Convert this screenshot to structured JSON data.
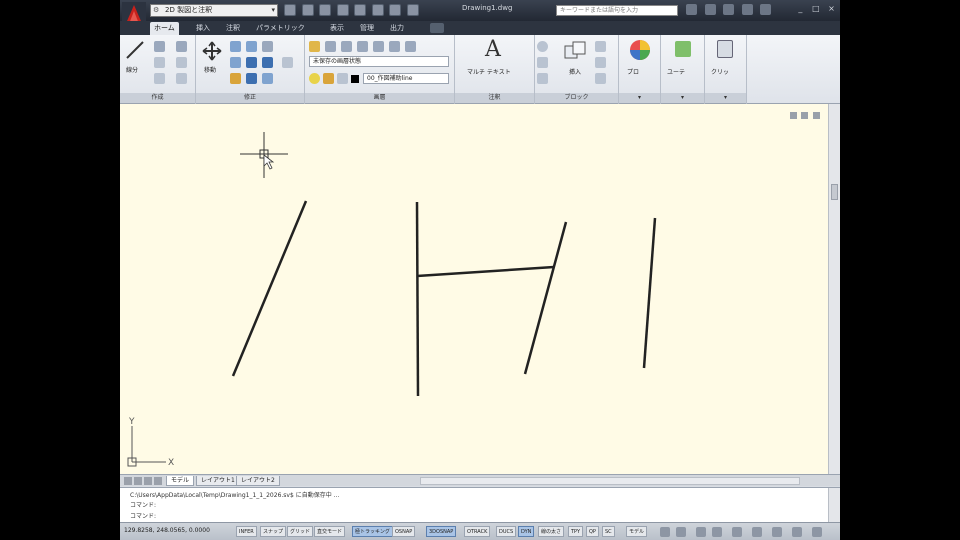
{
  "titlebar": {
    "workspace": "2D 製図と注釈",
    "file_title": "Drawing1.dwg",
    "search_placeholder": "キーワードまたは語句を入力",
    "win_min": "_",
    "win_max": "□",
    "win_close": "×"
  },
  "ribbon_tabs": [
    {
      "label": "ホーム",
      "active": true
    },
    {
      "label": "挿入"
    },
    {
      "label": "注釈"
    },
    {
      "label": "パラメトリック"
    },
    {
      "label": "表示"
    },
    {
      "label": "管理"
    },
    {
      "label": "出力"
    }
  ],
  "panels": {
    "draw": {
      "label": "作成",
      "line": "線分"
    },
    "modify": {
      "label": "修正",
      "move": "移動"
    },
    "layers": {
      "label": "画層",
      "state": "未保存の画層状態",
      "current": "00_作図補助line"
    },
    "annotation": {
      "label": "注釈",
      "mtext": "マルチ テキスト"
    },
    "block": {
      "label": "ブロック",
      "insert": "挿入"
    },
    "properties": {
      "label": "プロ"
    },
    "utilities": {
      "label": "ユーテ"
    },
    "clipboard": {
      "label": "クリッ"
    }
  },
  "layout_tabs": [
    "モデル",
    "レイアウト1",
    "レイアウト2"
  ],
  "command": {
    "line1": "C:\\Users\\AppData\\Local\\Temp\\Drawing1_1_1_2026.sv$ に自動保存中 ...",
    "line2": "コマンド:",
    "line3": "コマンド:"
  },
  "ucs": {
    "x": "X",
    "y": "Y"
  },
  "status": {
    "coords": "129.8258, 248.0565, 0.0000",
    "toggles": [
      {
        "label": "INFER",
        "on": false
      },
      {
        "label": "スナップ",
        "on": false
      },
      {
        "label": "グリッド",
        "on": false
      },
      {
        "label": "直交モード",
        "on": false
      },
      {
        "label": "極トラッキング",
        "on": true
      },
      {
        "label": "OSNAP",
        "on": false
      },
      {
        "label": "3DOSNAP",
        "on": true
      },
      {
        "label": "OTRACK",
        "on": false
      },
      {
        "label": "DUCS",
        "on": false
      },
      {
        "label": "DYN",
        "on": true
      },
      {
        "label": "線の太さ",
        "on": false
      },
      {
        "label": "TPY",
        "on": false
      },
      {
        "label": "QP",
        "on": false
      },
      {
        "label": "SC",
        "on": false
      },
      {
        "label": "モデル",
        "on": false
      }
    ]
  },
  "colors": {
    "drawing_bg": "#fffbe6",
    "line_color": "#222222",
    "logo_red": "#c8211c"
  }
}
